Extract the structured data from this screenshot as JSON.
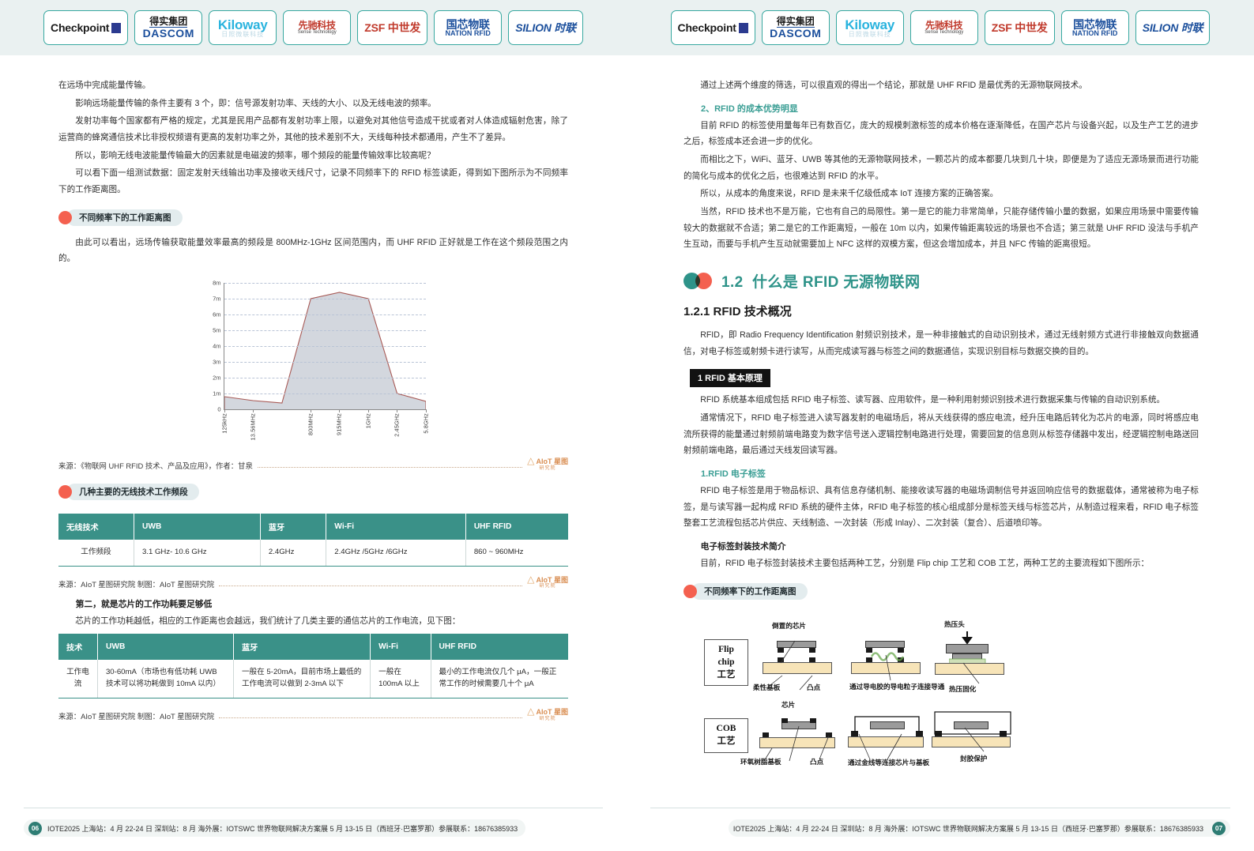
{
  "header": {
    "logos": [
      {
        "name": "checkpoint",
        "main": "Checkpoint",
        "sub": ""
      },
      {
        "name": "dascom",
        "top": "得实集团",
        "main": "DASCOM",
        "sub": ""
      },
      {
        "name": "kiloway",
        "main": "Kiloway",
        "sub": "日照微联科技"
      },
      {
        "name": "sense-technology",
        "main": "先驰科技",
        "sub": "Sense Technology"
      },
      {
        "name": "zsf",
        "main": "ZSF 中世发",
        "sub": ""
      },
      {
        "name": "nation-rfid",
        "main": "国芯物联",
        "sub": "NATION RFID"
      },
      {
        "name": "silion",
        "main": "SILION 时联",
        "sub": ""
      }
    ]
  },
  "left_page": {
    "paragraphs": [
      "在远场中完成能量传输。",
      "影响远场能量传输的条件主要有 3 个，即：信号源发射功率、天线的大小、以及无线电波的频率。",
      "发射功率每个国家都有严格的规定，尤其是民用产品都有发射功率上限，以避免对其他信号造成干扰或者对人体造成辐射危害，除了运营商的蜂窝通信技术比非授权频谱有更高的发射功率之外，其他的技术差别不大，天线每种技术都通用，产生不了差异。",
      "所以，影响无线电波能量传输最大的因素就是电磁波的频率，哪个频段的能量传输效率比较高呢？",
      "可以看下面一组测试数据：固定发射天线输出功率及接收天线尺寸，记录不同频率下的 RFID 标签读距，得到如下图所示为不同频率下的工作距离图。"
    ],
    "pill_heading_1": "不同频率下的工作距离图",
    "after_chart_intro": "由此可以看出，远场传输获取能量效率最高的频段是 800MHz-1GHz 区间范围内，而 UHF RFID 正好就是工作在这个频段范围之内的。",
    "chart_source": "来源：《物联网 UHF RFID 技术、产品及应用》，作者：甘泉",
    "pill_heading_2": "几种主要的无线技术工作频段",
    "table1": {
      "headers": [
        "无线技术",
        "UWB",
        "蓝牙",
        "Wi-Fi",
        "UHF RFID"
      ],
      "rows": [
        [
          "工作频段",
          "3.1 GHz- 10.6 GHz",
          "2.4GHz",
          "2.4GHz /5GHz /6GHz",
          "860 ~ 960MHz"
        ]
      ],
      "source": "来源：AIoT 星图研究院   制图：AIoT 星图研究院"
    },
    "second_heading": "第二，就是芯片的工作功耗要足够低",
    "second_para": "芯片的工作功耗越低，相应的工作距离也会越远，我们统计了几类主要的通信芯片的工作电流，见下图：",
    "table2": {
      "headers": [
        "技术",
        "UWB",
        "蓝牙",
        "Wi-Fi",
        "UHF RFID"
      ],
      "rows": [
        [
          "工作电流",
          "30-60mA（市场也有低功耗 UWB 技术可以将功耗做到 10mA 以内）",
          "一般在 5-20mA，目前市场上最低的工作电流可以做到 2-3mA 以下",
          "一般在 100mA 以上",
          "最小的工作电流仅几个 μA，一般正常工作的时候需要几十个 μA"
        ]
      ],
      "source": "来源：AIoT 星图研究院   制图：AIoT 星图研究院"
    },
    "watermark": "AIoT 星图研究院",
    "footer": {
      "page_number": "06",
      "text": "IOTE2025  上海站：4 月 22-24 日  深圳站：8 月  海外展：IOTSWC 世界物联网解决方案展  5 月 13-15 日（西班牙·巴塞罗那）参展联系：18676385933"
    }
  },
  "chart_data": {
    "type": "area",
    "title": "不同频率下的工作距离图",
    "categories": [
      "125kHz",
      "13.56MHz",
      "",
      "800MHz",
      "915MHz",
      "1GHz",
      "2.45GHz",
      "5.8GHz"
    ],
    "xtick_labels": [
      "125kHz",
      "13.56MHz",
      "800MHz",
      "915MHz",
      "1GHz",
      "2.45GHz",
      "5.8GHz"
    ],
    "values": [
      0.8,
      0.55,
      0.4,
      7.0,
      7.4,
      7.0,
      1.0,
      0.5
    ],
    "ylabel": "",
    "xlabel": "",
    "ylim": [
      0,
      8
    ],
    "ytick_labels": [
      "0",
      "1m",
      "2m",
      "3m",
      "4m",
      "5m",
      "6m",
      "7m",
      "8m"
    ],
    "grid": true,
    "legend": "none",
    "line_color": "#a85a56",
    "fill_color": "#d3d7de"
  },
  "right_page": {
    "paragraphs_top": [
      "通过上述两个维度的筛选，可以很直观的得出一个结论，那就是 UHF RFID 是最优秀的无源物联网技术。"
    ],
    "teal_heading_1": "2、RFID 的成本优势明显",
    "paragraphs_mid": [
      "目前 RFID 的标签使用量每年已有数百亿，庞大的规模刺激标签的成本价格在逐渐降低，在国产芯片与设备兴起，以及生产工艺的进步之后，标签成本还会进一步的优化。",
      "而相比之下，WiFi、蓝牙、UWB 等其他的无源物联网技术，一颗芯片的成本都要几块到几十块，即便是为了适应无源场景而进行功能的简化与成本的优化之后，也很难达到 RFID 的水平。",
      "所以，从成本的角度来说，RFID 是未来千亿级低成本 IoT 连接方案的正确答案。",
      "当然，RFID 技术也不是万能，它也有自己的局限性。第一是它的能力非常简单，只能存储传输小量的数据，如果应用场景中需要传输较大的数据就不合适；第二是它的工作距离短，一般在 10m 以内，如果传输距离较远的场景也不合适；第三就是 UHF RFID 没法与手机产生互动，而要与手机产生互动就需要加上 NFC 这样的双模方案，但这会增加成本，并且 NFC 传输的距离很短。"
    ],
    "section_number": "1.2",
    "section_title": "什么是 RFID 无源物联网",
    "subsection_title": "1.2.1  RFID 技术概况",
    "para_rfid_intro": "RFID，即 Radio Frequency Identification 射频识别技术，是一种非接触式的自动识别技术，通过无线射频方式进行非接触双向数据通信，对电子标签或射频卡进行读写，从而完成读写器与标签之间的数据通信，实现识别目标与数据交换的目的。",
    "black_badge": "1 RFID 基本原理",
    "paragraphs_principle": [
      "RFID 系统基本组成包括 RFID 电子标签、读写器、应用软件，是一种利用射频识别技术进行数据采集与传输的自动识别系统。",
      "通常情况下，RFID 电子标签进入读写器发射的电磁场后，将从天线获得的感应电流，经升压电路后转化为芯片的电源，同时将感应电流所获得的能量通过射频前端电路变为数字信号送入逻辑控制电路进行处理，需要回复的信息则从标签存储器中发出，经逻辑控制电路送回射频前端电路，最后通过天线发回读写器。"
    ],
    "teal_heading_2": "1.RFID 电子标签",
    "para_tag": "RFID 电子标签是用于物品标识、具有信息存储机制、能接收读写器的电磁场调制信号并返回响应信号的数据载体，通常被称为电子标签，是与读写器一起构成 RFID 系统的硬件主体，RFID 电子标签的核心组成部分是标签天线与标签芯片，从制造过程来看，RFID 电子标签整套工艺流程包括芯片供应、天线制造、一次封装（形成 Inlay）、二次封装（复合）、后道喷印等。",
    "bold_heading": "电子标签封装技术简介",
    "para_packaging": "目前，RFID 电子标签封装技术主要包括两种工艺，分别是 Flip chip 工艺和 COB 工艺，两种工艺的主要流程如下图所示：",
    "pill_heading": "不同频率下的工作距离图",
    "diagram": {
      "flip_chip_label": "Flip chip\n工艺",
      "cob_label": "COB\n工艺",
      "labels": [
        "倒置的芯片",
        "柔性基板",
        "凸点",
        "通过导电胶的导电粒子连接导通",
        "热压头",
        "热压固化",
        "芯片",
        "环氧树脂基板",
        "凸点",
        "通过金线等连接芯片与基板",
        "封胶保护"
      ]
    },
    "footer": {
      "page_number": "07",
      "text": "IOTE2025  上海站：4 月 22-24 日  深圳站：8 月  海外展：IOTSWC 世界物联网解决方案展  5 月 13-15 日（西班牙·巴塞罗那）参展联系：18676385933"
    }
  }
}
